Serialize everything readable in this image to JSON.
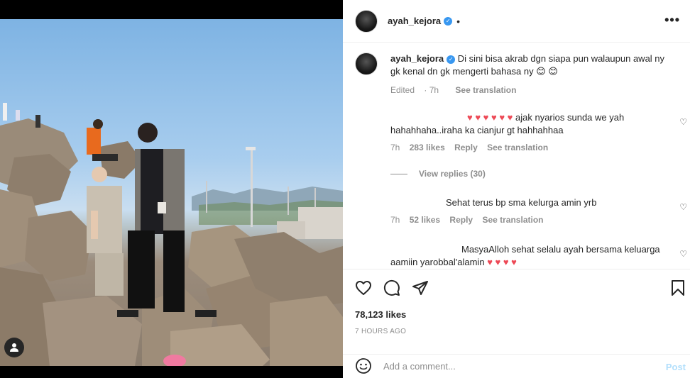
{
  "header": {
    "username": "ayah_kejora",
    "verified": "✓",
    "dot": "•",
    "more": "•••"
  },
  "caption": {
    "username": "ayah_kejora",
    "text": "Di sini bisa akrab dgn siapa pun walaupun awal ny gk kenal dn gk mengerti bahasa ny 😊 😊",
    "edited": "Edited",
    "time": "7h",
    "see_translation": "See translation"
  },
  "comments": [
    {
      "hearts": "♥ ♥ ♥ ♥ ♥ ♥",
      "text": "ajak nyarios sunda we yah hahahhaha..iraha ka cianjur gt hahhahhaa",
      "time": "7h",
      "likes": "283 likes",
      "reply": "Reply",
      "see_translation": "See translation"
    },
    {
      "text": "Sehat terus bp sma kelurga amin yrb",
      "time": "7h",
      "likes": "52 likes",
      "reply": "Reply",
      "see_translation": "See translation"
    },
    {
      "text": "MasyaAlloh sehat selalu ayah bersama keluarga aamiin yarobbal'alamin",
      "hearts": "♥ ♥ ♥ ♥"
    }
  ],
  "view_replies": "View replies (30)",
  "likes_count": "78,123 likes",
  "time_ago": "7 HOURS AGO",
  "add_comment": {
    "placeholder": "Add a comment...",
    "post": "Post"
  },
  "icons": {
    "like": "heart-icon",
    "comment": "comment-icon",
    "share": "share-icon",
    "save": "bookmark-icon",
    "emoji": "emoji-icon",
    "user_tag": "user-tag-icon"
  },
  "colors": {
    "accent": "#3897f0",
    "heart_red": "#ed4956",
    "muted": "#8e8e8e",
    "post_disabled": "#b2dffc"
  }
}
